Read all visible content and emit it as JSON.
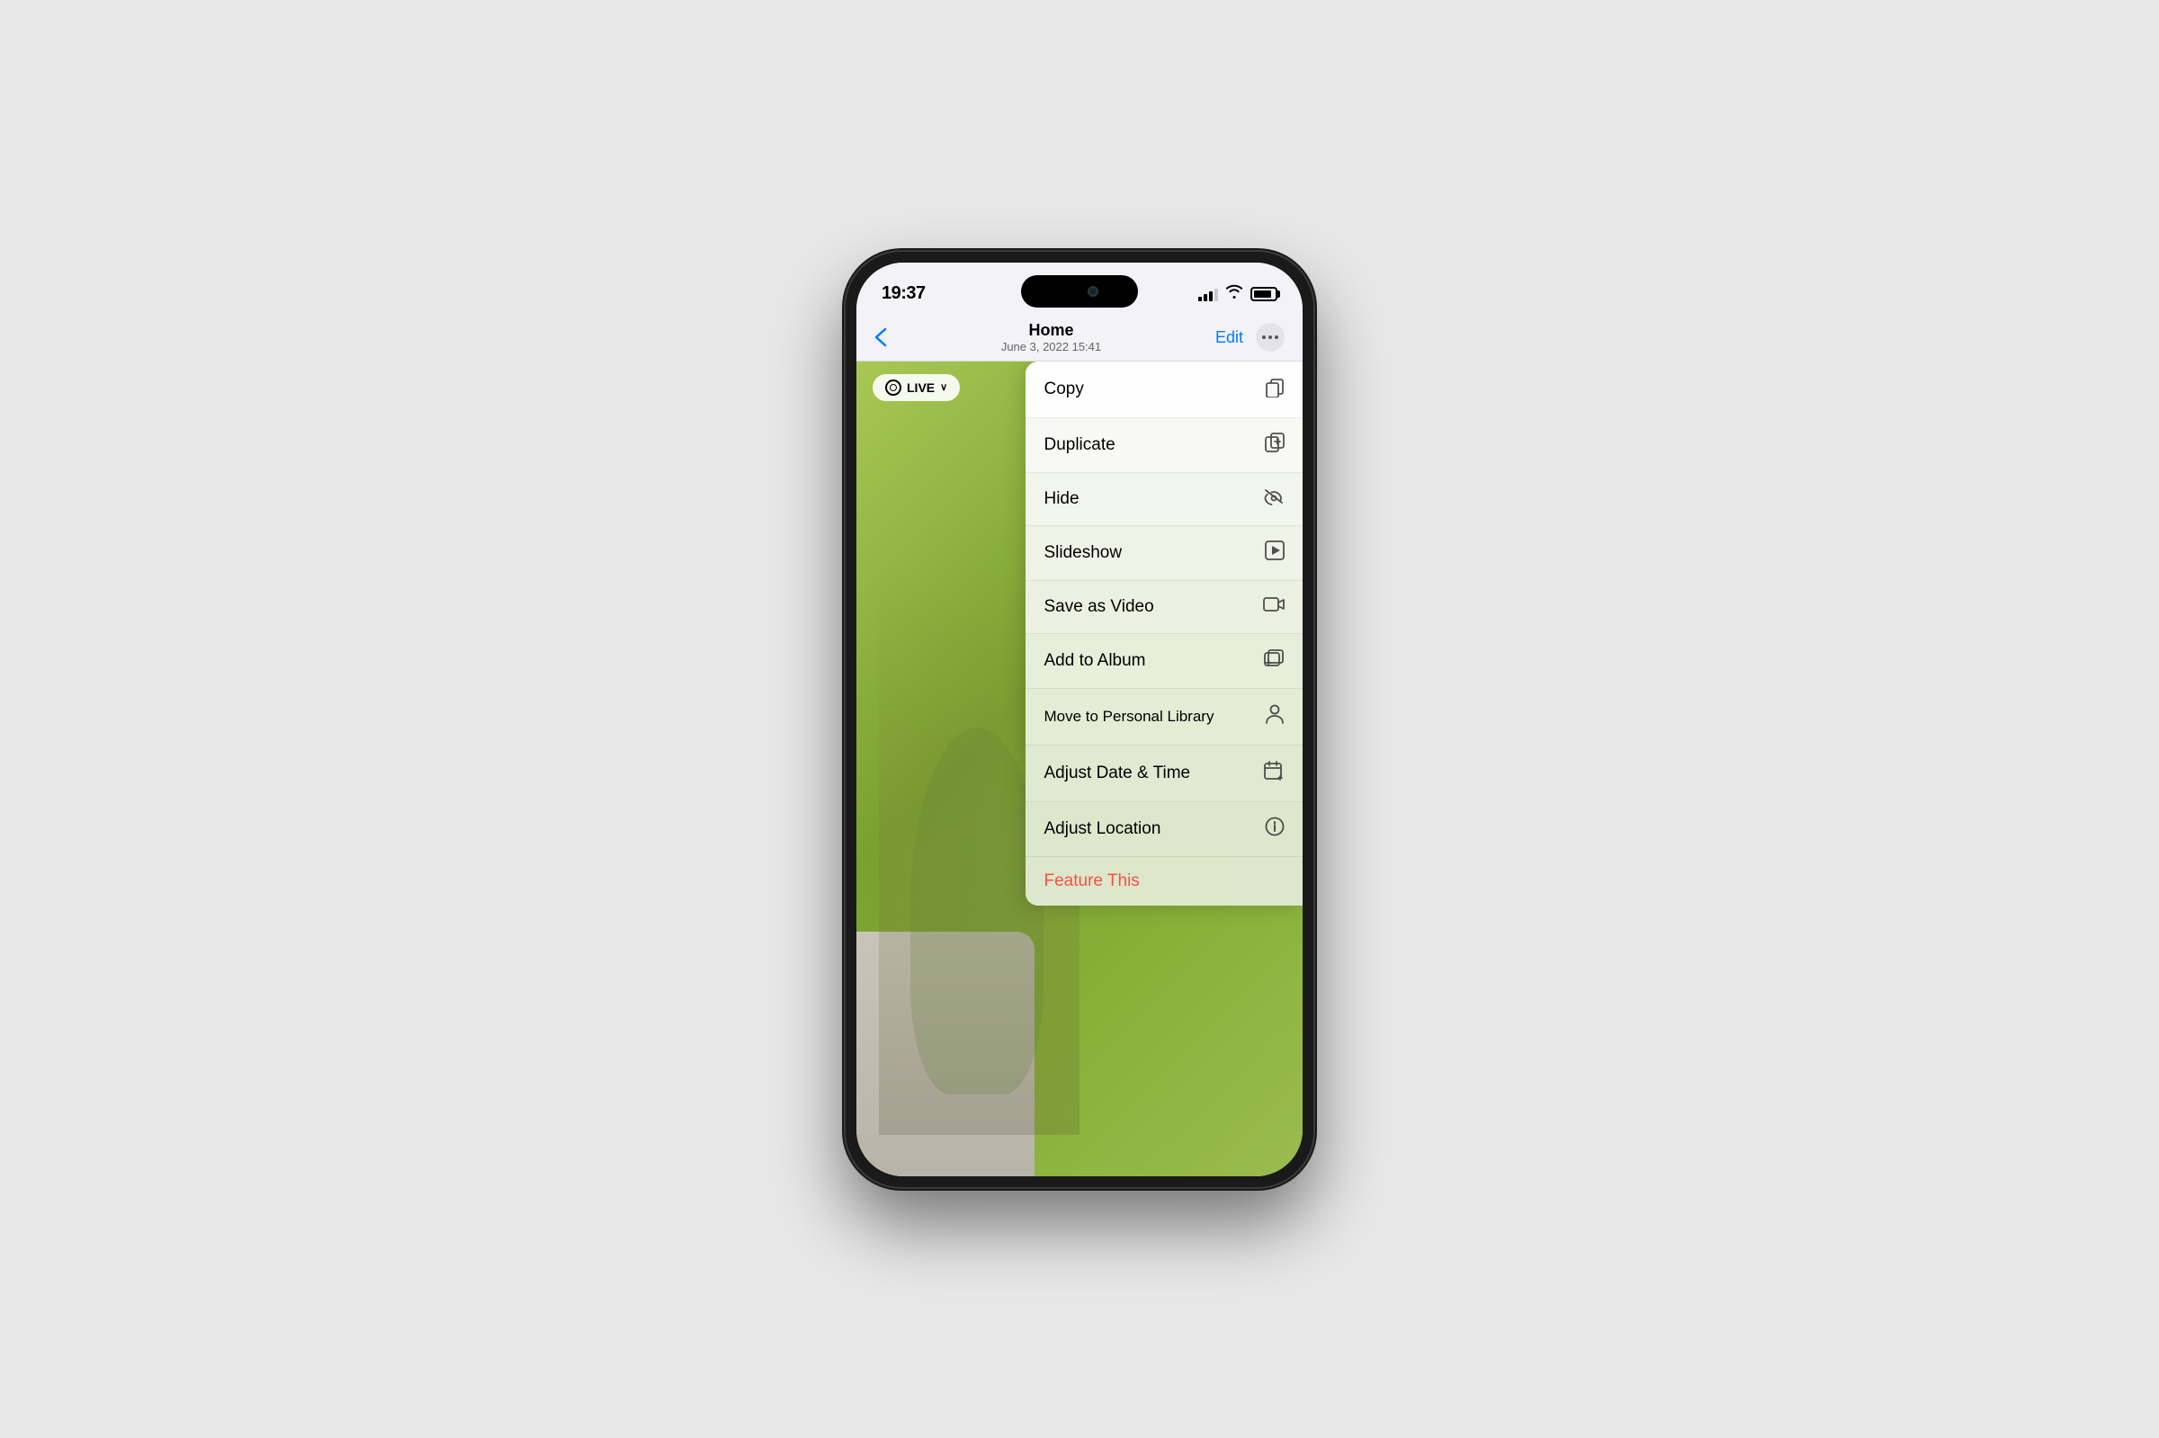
{
  "device": {
    "time": "19:37"
  },
  "nav": {
    "back_label": "‹",
    "title": "Home",
    "subtitle": "June 3, 2022  15:41",
    "edit_label": "Edit",
    "more_label": "···"
  },
  "live_badge": {
    "label": "LIVE",
    "chevron": "∨"
  },
  "menu": {
    "items": [
      {
        "label": "Copy",
        "icon": "⎘"
      },
      {
        "label": "Duplicate",
        "icon": "⊕"
      },
      {
        "label": "Hide",
        "icon": "⊘"
      },
      {
        "label": "Slideshow",
        "icon": "▶"
      },
      {
        "label": "Save as Video",
        "icon": "⬛"
      },
      {
        "label": "Add to Album",
        "icon": "⊞"
      },
      {
        "label": "Move to Personal Library",
        "icon": "👤"
      },
      {
        "label": "Adjust Date & Time",
        "icon": "📅"
      },
      {
        "label": "Adjust Location",
        "icon": "ℹ"
      }
    ],
    "feature_label": "Feature This"
  },
  "colors": {
    "accent_blue": "#007aff",
    "danger_red": "#ff3b30",
    "menu_bg": "rgba(248,248,248,0.97)"
  }
}
